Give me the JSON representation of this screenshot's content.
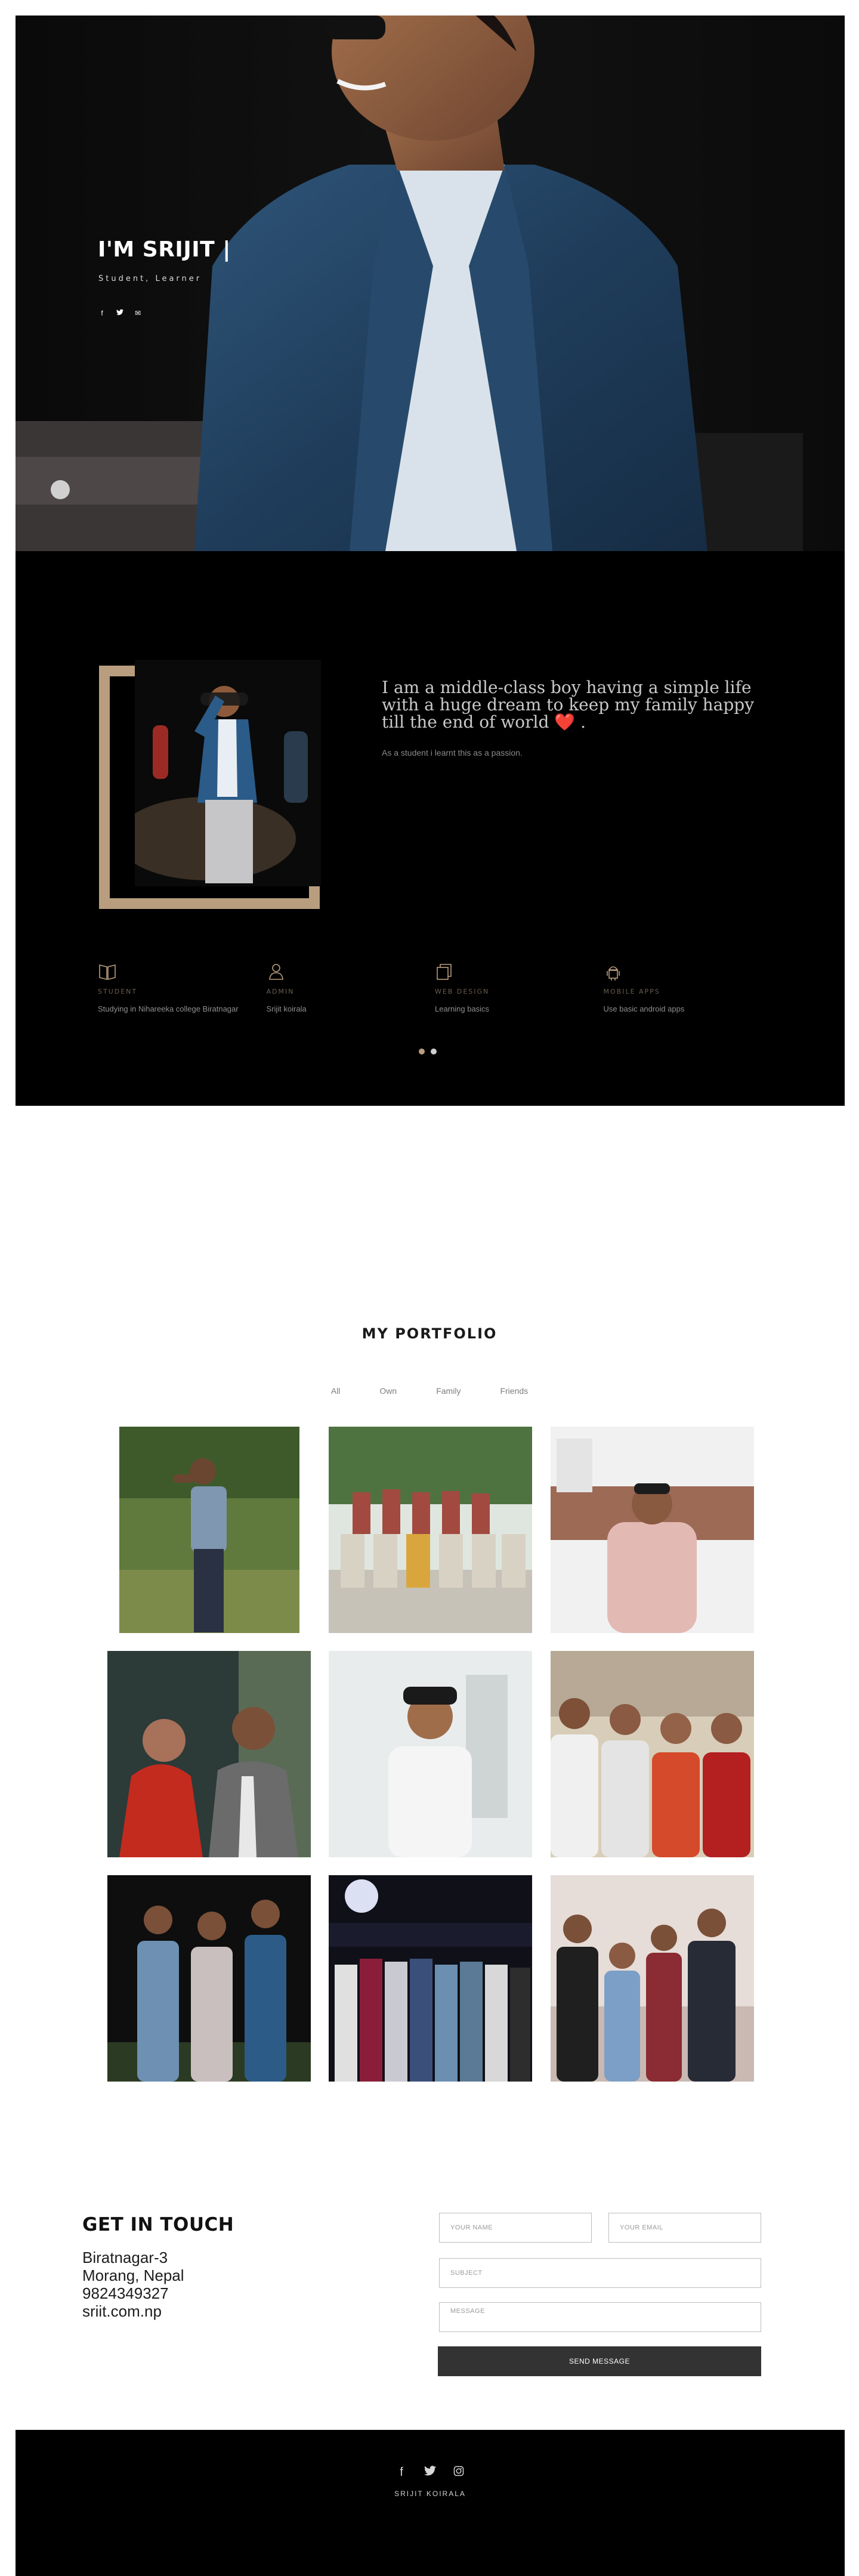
{
  "hero": {
    "title": "I'M SRIJIT |",
    "subtitle": "Student, Learner",
    "social": [
      {
        "icon": "facebook-icon",
        "glyph": "f"
      },
      {
        "icon": "twitter-icon",
        "glyph": "t"
      },
      {
        "icon": "email-icon",
        "glyph": "✉"
      }
    ]
  },
  "about": {
    "quote": "I am a middle-class boy having a simple life with a huge dream to keep my family happy till the end of world",
    "heart": "❤️",
    "quote_end": ".",
    "note": "As a student i learnt this as a passion.",
    "skills": [
      {
        "icon": "book-icon",
        "title": "STUDENT",
        "text": "Studying in Nihareeka college Biratnagar"
      },
      {
        "icon": "admin-icon",
        "title": "ADMIN",
        "text": "Srijit koirala"
      },
      {
        "icon": "web-design-icon",
        "title": "WEB DESIGN",
        "text": "Learning basics"
      },
      {
        "icon": "android-icon",
        "title": "MOBILE APPS",
        "text": "Use basic android apps"
      }
    ]
  },
  "portfolio": {
    "title": "MY PORTFOLIO",
    "filters": [
      "All",
      "Own",
      "Family",
      "Friends"
    ]
  },
  "contact": {
    "title": "GET IN TOUCH",
    "lines": [
      "Biratnagar-3",
      "Morang, Nepal",
      "9824349327",
      "sriit.com.np"
    ],
    "name_placeholder": "YOUR NAME",
    "email_placeholder": "YOUR EMAIL",
    "subject_placeholder": "SUBJECT",
    "message_placeholder": "MESSAGE",
    "send_label": "SEND MESSAGE"
  },
  "footer": {
    "social": [
      {
        "icon": "facebook-icon",
        "glyph": "f"
      },
      {
        "icon": "twitter-icon",
        "glyph": "t"
      },
      {
        "icon": "instagram-icon",
        "glyph": "◎"
      }
    ],
    "name": "SRIJIT KOIRALA"
  },
  "colors": {
    "accent": "#b89e7e",
    "dark": "#000000",
    "button": "#333333"
  }
}
